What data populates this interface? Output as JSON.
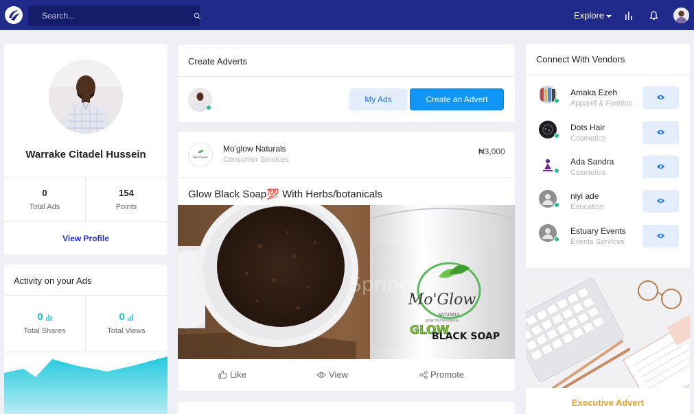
{
  "nav": {
    "search_placeholder": "Search...",
    "explore_label": "Explore"
  },
  "profile": {
    "name": "Warrake Citadel Hussein",
    "stats": [
      {
        "value": "0",
        "label": "Total Ads"
      },
      {
        "value": "154",
        "label": "Points"
      }
    ],
    "view_profile": "View Profile"
  },
  "activity": {
    "title": "Activity on your Ads",
    "stats": [
      {
        "value": "0",
        "label": "Total Shares"
      },
      {
        "value": "0",
        "label": "Total Views"
      }
    ]
  },
  "create_adverts": {
    "title": "Create Adverts",
    "my_ads_label": "My Ads",
    "create_label": "Create an Advert"
  },
  "post": {
    "vendor_name": "Mo'glow Naturals",
    "vendor_category": "Consumer Services",
    "price": "₦3,000",
    "title": "Glow Black Soap💯 With Herbs/botanicals",
    "image_text": {
      "brand": "Mo'Glow",
      "naturals": "NATURALS",
      "tagline": "glow tremendously",
      "glow": "GLOW",
      "black_soap": "BLACK SOAP",
      "watermark": "Spring"
    },
    "actions": {
      "like": "Like",
      "view": "View",
      "promote": "Promote"
    }
  },
  "vendors": {
    "title": "Connect With Vendors",
    "items": [
      {
        "name": "Amaka Ezeh",
        "category": "Apparel & Fashion"
      },
      {
        "name": "Dots Hair",
        "category": "Cosmetics"
      },
      {
        "name": "Ada Sandra",
        "category": "Cosmetics"
      },
      {
        "name": "niyi ade",
        "category": "Education"
      },
      {
        "name": "Estuary Events",
        "category": "Events Services"
      }
    ]
  },
  "executive_advert": {
    "label": "Executive Advert"
  },
  "colors": {
    "nav_bg": "#1f2a8a",
    "primary_button": "#1196f5",
    "accent_cyan": "#13c7d8",
    "online_green": "#22c08a",
    "executive_gold": "#e0a32c"
  },
  "icons": {
    "logo": "app-logo-icon",
    "search": "search-icon",
    "stats": "bar-chart-icon",
    "notifications": "bell-icon",
    "eye": "eye-icon",
    "like": "thumbs-up-icon",
    "share": "share-icon"
  }
}
